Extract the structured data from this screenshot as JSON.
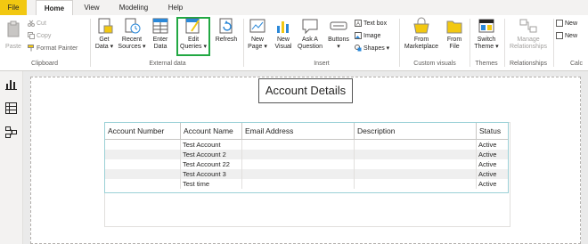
{
  "tabs": [
    {
      "label": "File"
    },
    {
      "label": "Home"
    },
    {
      "label": "View"
    },
    {
      "label": "Modeling"
    },
    {
      "label": "Help"
    }
  ],
  "ribbon": {
    "clipboard": {
      "paste": "Paste",
      "cut": "Cut",
      "copy": "Copy",
      "format_painter": "Format Painter",
      "group": "Clipboard"
    },
    "external_data": {
      "get_data": "Get Data ▾",
      "get_data_1": "Get",
      "get_data_2": "Data ▾",
      "recent_sources_1": "Recent",
      "recent_sources_2": "Sources ▾",
      "enter_data_1": "Enter",
      "enter_data_2": "Data",
      "edit_queries_1": "Edit",
      "edit_queries_2": "Queries ▾",
      "refresh": "Refresh",
      "group": "External data"
    },
    "insert": {
      "new_page_1": "New",
      "new_page_2": "Page ▾",
      "new_visual_1": "New",
      "new_visual_2": "Visual",
      "ask_question_1": "Ask A",
      "ask_question_2": "Question",
      "buttons_1": "Buttons",
      "buttons_2": "▾",
      "text_box": "Text box",
      "image": "Image",
      "shapes": "Shapes ▾",
      "group": "Insert"
    },
    "custom_visuals": {
      "from_marketplace_1": "From",
      "from_marketplace_2": "Marketplace",
      "from_file_1": "From",
      "from_file_2": "File",
      "group": "Custom visuals"
    },
    "themes": {
      "switch_theme_1": "Switch",
      "switch_theme_2": "Theme ▾",
      "group": "Themes"
    },
    "relationships": {
      "manage_1": "Manage",
      "manage_2": "Relationships",
      "group": "Relationships"
    },
    "calculations": {
      "new_measure": "New",
      "new_column": "New",
      "group": "Calc"
    }
  },
  "report": {
    "title": "Account Details",
    "table": {
      "columns": [
        "Account Number",
        "Account Name",
        "Email Address",
        "Description",
        "Status"
      ],
      "rows": [
        [
          "",
          "Test Account",
          "",
          "",
          "Active"
        ],
        [
          "",
          "Test Account 2",
          "",
          "",
          "Active"
        ],
        [
          "",
          "Test Account 22",
          "",
          "",
          "Active"
        ],
        [
          "",
          "Test Account 3",
          "",
          "",
          "Active"
        ],
        [
          "",
          "Test time",
          "",
          "",
          "Active"
        ]
      ]
    }
  },
  "colors": {
    "file_tab": "#f2c811",
    "highlight_border": "#22a843",
    "accent": "#2b88d8"
  },
  "icons": [
    "cut-icon",
    "copy-icon",
    "format-painter-icon",
    "paste-icon",
    "get-data-icon",
    "recent-sources-icon",
    "enter-data-icon",
    "edit-queries-icon",
    "refresh-icon",
    "new-page-icon",
    "new-visual-icon",
    "ask-question-icon",
    "buttons-icon",
    "text-box-icon",
    "image-icon",
    "shapes-icon",
    "marketplace-icon",
    "from-file-icon",
    "switch-theme-icon",
    "manage-relationships-icon",
    "report-view-icon",
    "data-view-icon",
    "model-view-icon"
  ]
}
